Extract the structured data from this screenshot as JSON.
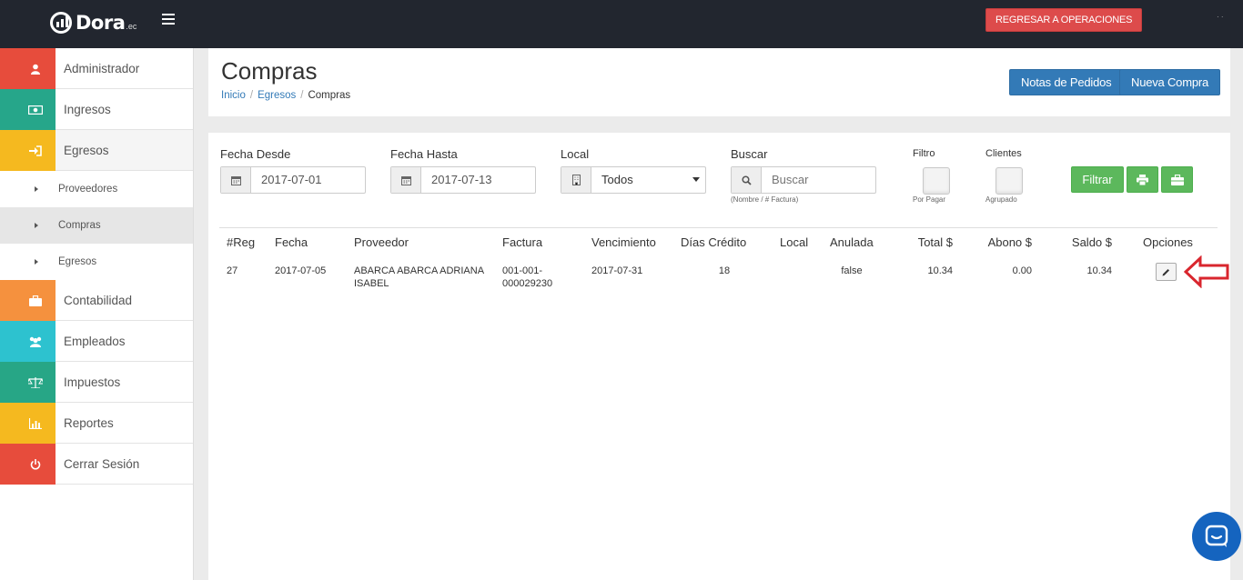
{
  "topbar": {
    "logo_text": "Dora",
    "logo_suffix": ".ec",
    "regresar_label": "REGRESAR A OPERACIONES"
  },
  "sidebar": {
    "items": [
      {
        "label": "Administrador",
        "icon": "user-icon",
        "color": "#e74c3c"
      },
      {
        "label": "Ingresos",
        "icon": "money-icon",
        "color": "#26a68a"
      },
      {
        "label": "Egresos",
        "icon": "sign-in-icon",
        "color": "#f5b91f"
      },
      {
        "label": "Contabilidad",
        "icon": "briefcase-icon",
        "color": "#f5913e"
      },
      {
        "label": "Empleados",
        "icon": "users-icon",
        "color": "#2dc2cf"
      },
      {
        "label": "Impuestos",
        "icon": "balance-scale-icon",
        "color": "#27a686"
      },
      {
        "label": "Reportes",
        "icon": "bar-chart-icon",
        "color": "#f5b91f"
      },
      {
        "label": "Cerrar Sesión",
        "icon": "power-icon",
        "color": "#e74c3c"
      }
    ],
    "subitems": [
      "Proveedores",
      "Compras",
      "Egresos"
    ]
  },
  "header": {
    "title": "Compras",
    "breadcrumb": [
      "Inicio",
      "Egresos",
      "Compras"
    ],
    "notas_label": "Notas de Pedidos",
    "nueva_label": "Nueva Compra"
  },
  "filters": {
    "fecha_desde_label": "Fecha Desde",
    "fecha_desde_value": "2017-07-01",
    "fecha_hasta_label": "Fecha Hasta",
    "fecha_hasta_value": "2017-07-13",
    "local_label": "Local",
    "local_value": "Todos",
    "buscar_label": "Buscar",
    "buscar_placeholder": "Buscar",
    "buscar_hint": "(Nombre / # Factura)",
    "filtro_label": "Filtro",
    "filtro_hint": "Por Pagar",
    "clientes_label": "Clientes",
    "clientes_hint": "Agrupado",
    "filtrar_label": "Filtrar"
  },
  "table": {
    "headers": [
      "#Reg",
      "Fecha",
      "Proveedor",
      "Factura",
      "Vencimiento",
      "Días Crédito",
      "Local",
      "Anulada",
      "Total $",
      "Abono $",
      "Saldo $",
      "Opciones"
    ],
    "rows": [
      {
        "reg": "27",
        "fecha": "2017-07-05",
        "proveedor_1": "ABARCA ABARCA ADRIANA",
        "proveedor_2": "ISABEL",
        "factura_1": "001-001-",
        "factura_2": "000029230",
        "vencimiento": "2017-07-31",
        "dias_credito": "18",
        "local": "",
        "anulada": "false",
        "total": "10.34",
        "abono": "0.00",
        "saldo": "10.34"
      }
    ]
  },
  "colors": {
    "topbar": "#22262f",
    "primary": "#337ab7",
    "success": "#5cb85c",
    "danger": "#dd4b4b",
    "arrow": "#d9262e"
  }
}
